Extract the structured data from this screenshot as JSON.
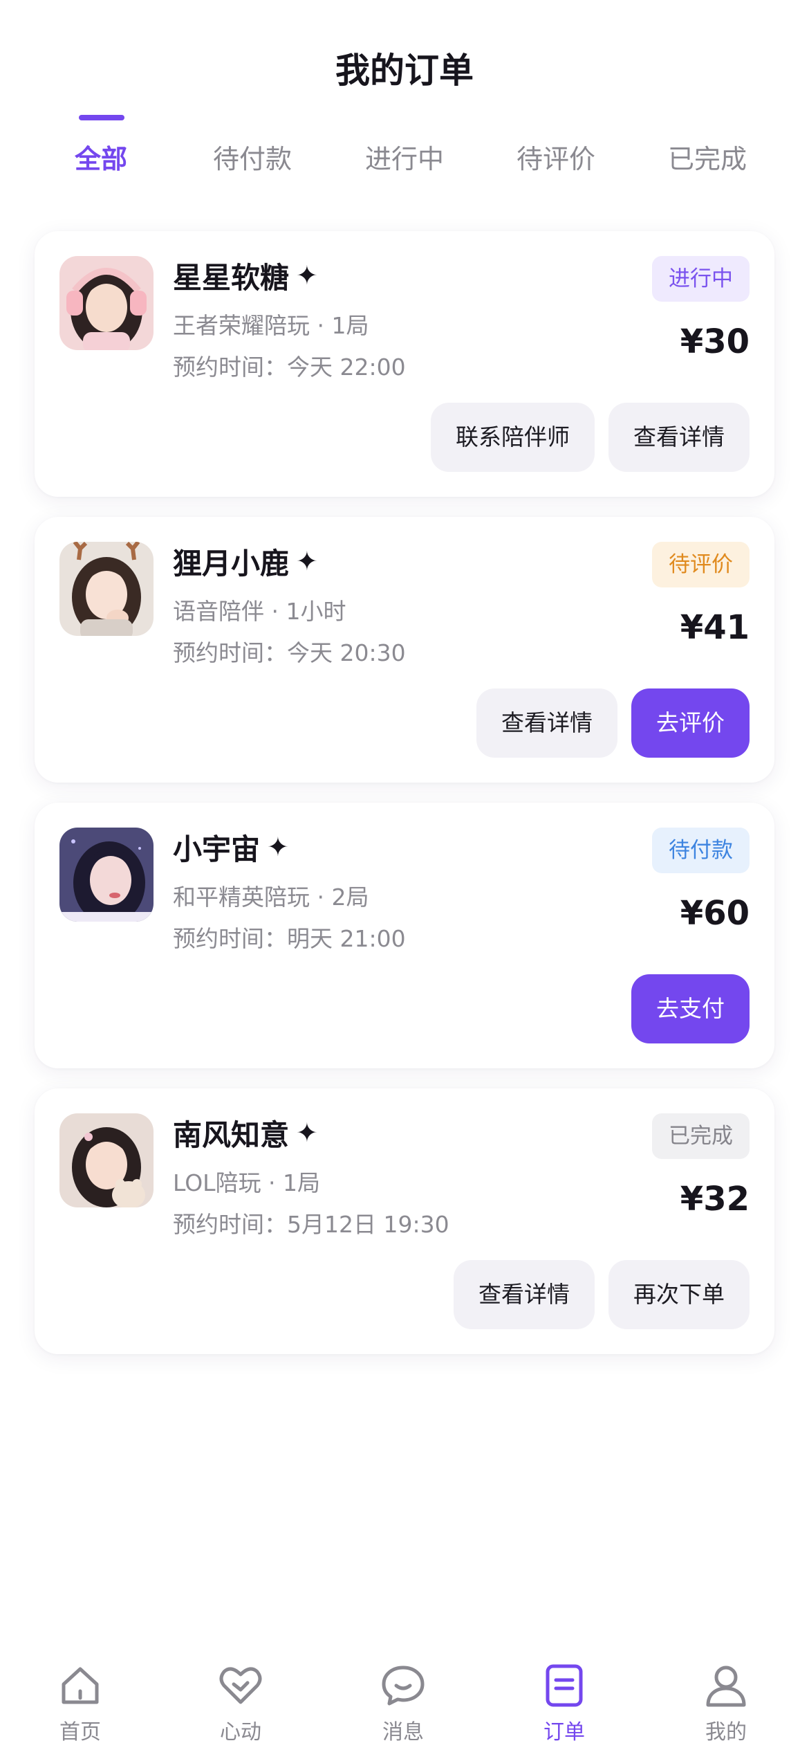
{
  "header": {
    "title": "我的订单"
  },
  "tabs": [
    "全部",
    "待付款",
    "进行中",
    "待评价",
    "已完成"
  ],
  "active_tab": 0,
  "sparkle_glyph": "✦",
  "orders": [
    {
      "name": "星星软糖",
      "service": "王者荣耀陪玩 · 1局",
      "time": "预约时间：今天 22:00",
      "status": "进行中",
      "price": "¥30",
      "actions": [
        "联系陪伴师",
        "查看详情"
      ]
    },
    {
      "name": "狸月小鹿",
      "service": "语音陪伴 · 1小时",
      "time": "预约时间：今天 20:30",
      "status": "待评价",
      "price": "¥41",
      "actions": [
        "查看详情",
        "去评价"
      ]
    },
    {
      "name": "小宇宙",
      "service": "和平精英陪玩 · 2局",
      "time": "预约时间：明天 21:00",
      "status": "待付款",
      "price": "¥60",
      "actions": [
        "去支付"
      ]
    },
    {
      "name": "南风知意",
      "service": "LOL陪玩 · 1局",
      "time": "预约时间：5月12日 19:30",
      "status": "已完成",
      "price": "¥32",
      "actions": [
        "查看详情",
        "再次下单"
      ]
    }
  ],
  "bottom_nav": [
    {
      "label": "首页",
      "icon": "home-icon"
    },
    {
      "label": "心动",
      "icon": "heart-icon"
    },
    {
      "label": "消息",
      "icon": "chat-icon"
    },
    {
      "label": "订单",
      "icon": "order-icon"
    },
    {
      "label": "我的",
      "icon": "profile-icon"
    }
  ],
  "colors": {
    "accent": "#7447ee",
    "status_ongoing": "#7a52ee",
    "status_review": "#e08a1e",
    "status_unpaid": "#3d84e0",
    "status_done": "#85848b"
  }
}
